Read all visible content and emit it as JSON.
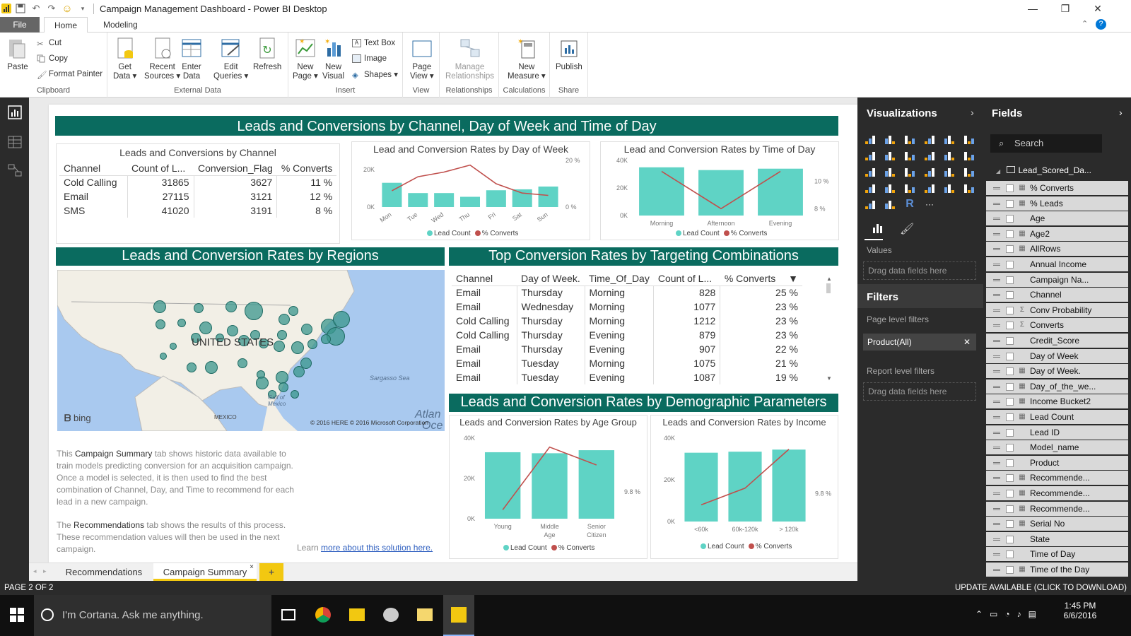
{
  "window": {
    "title": "Campaign Management Dashboard - Power BI Desktop"
  },
  "ribbon_tabs": [
    "File",
    "Home",
    "Modeling"
  ],
  "ribbon": {
    "clipboard": {
      "paste": "Paste",
      "cut": "Cut",
      "copy": "Copy",
      "format_painter": "Format Painter",
      "group": "Clipboard"
    },
    "external": {
      "get_data": "Get",
      "get_data2": "Data ▾",
      "recent": "Recent",
      "recent2": "Sources ▾",
      "enter": "Enter",
      "enter2": "Data",
      "edit": "Edit",
      "edit2": "Queries ▾",
      "refresh": "Refresh",
      "group": "External Data"
    },
    "insert": {
      "new_page": "New",
      "new_page2": "Page ▾",
      "new_visual": "New",
      "new_visual2": "Visual",
      "text_box": "Text Box",
      "image": "Image",
      "shapes": "Shapes ▾",
      "group": "Insert"
    },
    "view": {
      "page_view": "Page",
      "page_view2": "View ▾",
      "group": "View"
    },
    "relationships": {
      "manage": "Manage",
      "manage2": "Relationships",
      "group": "Relationships"
    },
    "calc": {
      "new_measure": "New",
      "new_measure2": "Measure ▾",
      "group": "Calculations"
    },
    "share": {
      "publish": "Publish",
      "group": "Share"
    }
  },
  "report": {
    "banner_top": "Leads and Conversions by Channel, Day of Week and Time of Day",
    "channel_table": {
      "title": "Leads and Conversions by Channel",
      "headers": [
        "Channel",
        "Count of L...",
        "Conversion_Flag",
        "% Converts"
      ],
      "rows": [
        [
          "Cold Calling",
          "31865",
          "3627",
          "11 %"
        ],
        [
          "Email",
          "27115",
          "3121",
          "12 %"
        ],
        [
          "SMS",
          "41020",
          "3191",
          "8 %"
        ]
      ]
    },
    "banner_regions": "Leads and Conversion Rates by Regions",
    "map": {
      "country": "UNITED STATES",
      "sea": "Sargasso Sea",
      "gulf": "Gulf of",
      "gulf2": "Mexico",
      "mexico": "MEXICO",
      "atlantic": "Atlan",
      "atlantic2": "Oce",
      "bing": "bing",
      "copyright": "© 2016 HERE    © 2016 Microsoft Corporation"
    },
    "banner_targeting": "Top Conversion Rates by Targeting Combinations",
    "targeting_table": {
      "headers": [
        "Channel",
        "Day of Week.",
        "Time_Of_Day",
        "Count of L...",
        "% Converts"
      ],
      "rows": [
        [
          "Email",
          "Thursday",
          "Morning",
          "828",
          "25 %"
        ],
        [
          "Email",
          "Wednesday",
          "Morning",
          "1077",
          "23 %"
        ],
        [
          "Cold Calling",
          "Thursday",
          "Morning",
          "1212",
          "23 %"
        ],
        [
          "Cold Calling",
          "Thursday",
          "Evening",
          "879",
          "23 %"
        ],
        [
          "Email",
          "Thursday",
          "Evening",
          "907",
          "22 %"
        ],
        [
          "Email",
          "Tuesday",
          "Morning",
          "1075",
          "21 %"
        ],
        [
          "Email",
          "Tuesday",
          "Evening",
          "1087",
          "19 %"
        ]
      ]
    },
    "banner_demo": "Leads and Conversion Rates by Demographic Parameters",
    "summary": {
      "p1a": "This ",
      "p1b": "Campaign Summary",
      "p1c": " tab shows historic data available to train models predicting conversion for an acquisition campaign. Once a model is selected, it is then used to find the best combination of Channel, Day, and Time to recommend for each lead in a new campaign.",
      "p2a": "The ",
      "p2b": "Recommendations",
      "p2c": " tab shows the results  of this process. These recommendation values will then be used in the next campaign.",
      "learn": "Learn ",
      "link": "more about this solution here."
    },
    "legend_lead": "Lead Count",
    "legend_conv": "% Converts"
  },
  "chart_data": [
    {
      "type": "bar",
      "title": "Lead and Conversion Rates by Day of Week",
      "categories": [
        "Mon",
        "Tue",
        "Wed",
        "Thu",
        "Fri",
        "Sat",
        "Sun"
      ],
      "series": [
        {
          "name": "Lead Count",
          "values": [
            13000,
            7500,
            7500,
            5500,
            9000,
            9500,
            11000
          ]
        },
        {
          "name": "% Converts",
          "values": [
            0.07,
            0.13,
            0.15,
            0.18,
            0.1,
            0.06,
            0.05
          ]
        }
      ],
      "y_ticks": [
        "20K",
        "0K"
      ],
      "y2_ticks": [
        "20 %",
        "0 %"
      ],
      "ylim": [
        0,
        25000
      ],
      "y2lim": [
        0,
        0.2
      ]
    },
    {
      "type": "bar",
      "title": "Lead and Conversion Rates by  Time of Day",
      "categories": [
        "Morning",
        "Afternoon",
        "Evening"
      ],
      "series": [
        {
          "name": "Lead Count",
          "values": [
            35000,
            33000,
            34000
          ]
        },
        {
          "name": "% Converts",
          "values": [
            0.107,
            0.08,
            0.107
          ]
        }
      ],
      "y_ticks": [
        "40K",
        "20K",
        "0K"
      ],
      "y2_ticks": [
        "10 %",
        "8 %"
      ],
      "ylim": [
        0,
        40000
      ],
      "y2lim": [
        0.075,
        0.115
      ]
    },
    {
      "type": "bar",
      "title": "Leads and Conversion Rates by Age Group",
      "categories": [
        "Young",
        "Middle Age",
        "Senior Citizen"
      ],
      "series": [
        {
          "name": "Lead Count",
          "values": [
            33000,
            32500,
            34000
          ]
        },
        {
          "name": "% Converts",
          "values": [
            0.094,
            0.108,
            0.104
          ]
        }
      ],
      "y_ticks": [
        "40K",
        "20K",
        "0K"
      ],
      "y2_ticks": [
        "9.8 %"
      ],
      "ylim": [
        0,
        40000
      ],
      "y2lim": [
        0.092,
        0.11
      ]
    },
    {
      "type": "bar",
      "title": "Leads and Conversion Rates by Income",
      "categories": [
        "<60k",
        "60k-120k",
        "> 120k"
      ],
      "series": [
        {
          "name": "Lead Count",
          "values": [
            33000,
            33500,
            34500
          ]
        },
        {
          "name": "% Converts",
          "values": [
            0.096,
            0.099,
            0.106
          ]
        }
      ],
      "y_ticks": [
        "40K",
        "20K",
        "0K"
      ],
      "y2_ticks": [
        "9.8 %"
      ],
      "ylim": [
        0,
        40000
      ],
      "y2lim": [
        0.093,
        0.108
      ]
    }
  ],
  "page_tabs": [
    "Recommendations",
    "Campaign Summary"
  ],
  "status": {
    "page": "PAGE 2 OF 2",
    "update": "UPDATE AVAILABLE (CLICK TO DOWNLOAD)"
  },
  "viz_pane": {
    "title": "Visualizations",
    "values": "Values",
    "drag": "Drag data fields here",
    "filters": "Filters",
    "page_filters": "Page level filters",
    "filter_chip": "Product(All)",
    "report_filters": "Report level filters",
    "drag2": "Drag data fields here"
  },
  "fields_pane": {
    "title": "Fields",
    "search": "Search",
    "table": "Lead_Scored_Da...",
    "fields": [
      [
        "% Converts",
        "m"
      ],
      [
        "% Leads",
        "c"
      ],
      [
        "Age",
        ""
      ],
      [
        "Age2",
        "c"
      ],
      [
        "AllRows",
        "c"
      ],
      [
        "Annual Income",
        ""
      ],
      [
        "Campaign Na...",
        ""
      ],
      [
        "Channel",
        ""
      ],
      [
        "Conv Probability",
        "Σ"
      ],
      [
        "Converts",
        "Σ"
      ],
      [
        "Credit_Score",
        ""
      ],
      [
        "Day of Week",
        ""
      ],
      [
        "Day of Week.",
        "c"
      ],
      [
        "Day_of_the_we...",
        "c"
      ],
      [
        "Income Bucket2",
        "c"
      ],
      [
        "Lead Count",
        "c"
      ],
      [
        "Lead ID",
        ""
      ],
      [
        "Model_name",
        ""
      ],
      [
        "Product",
        ""
      ],
      [
        "Recommende...",
        "c"
      ],
      [
        "Recommende...",
        "c"
      ],
      [
        "Recommende...",
        "c"
      ],
      [
        "Serial No",
        "c"
      ],
      [
        "State",
        ""
      ],
      [
        "Time of Day",
        ""
      ],
      [
        "Time of the Day",
        "c"
      ]
    ]
  },
  "taskbar": {
    "cortana": "I'm Cortana. Ask me anything.",
    "time": "1:45 PM",
    "date": "6/6/2016"
  },
  "colors": {
    "teal_bar": "#5fd3c5",
    "line": "#c0504d",
    "banner": "#0a6b5f",
    "pane": "#2b2b2b",
    "accent": "#f2c811"
  }
}
